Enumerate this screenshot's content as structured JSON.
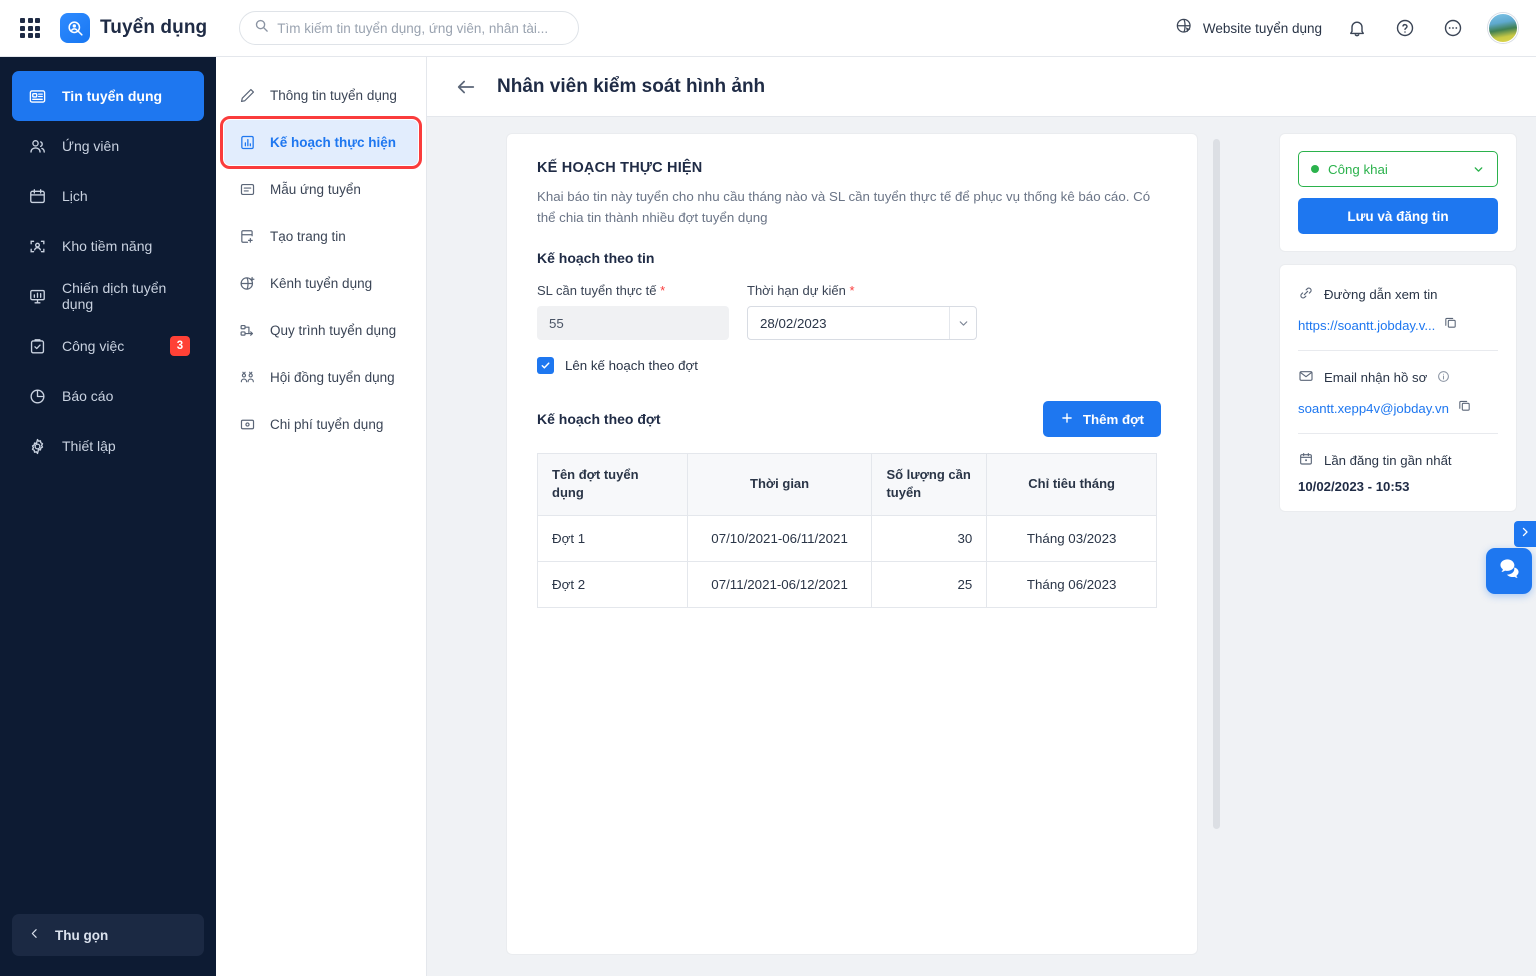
{
  "topbar": {
    "app_launcher": "grid-icon",
    "brand_name": "Tuyển dụng",
    "search_placeholder": "Tìm kiếm tin tuyển dụng, ứng viên, nhân tài...",
    "search_value": "",
    "website_link": "Website tuyển dụng"
  },
  "sidebar": {
    "items": [
      {
        "label": "Tin tuyển dụng",
        "icon": "news-card-icon",
        "active": true,
        "badge": ""
      },
      {
        "label": "Ứng viên",
        "icon": "users-icon",
        "active": false,
        "badge": ""
      },
      {
        "label": "Lịch",
        "icon": "calendar-icon",
        "active": false,
        "badge": ""
      },
      {
        "label": "Kho tiềm năng",
        "icon": "talent-scan-icon",
        "active": false,
        "badge": ""
      },
      {
        "label": "Chiến dịch tuyển dụng",
        "icon": "campaign-board-icon",
        "active": false,
        "badge": ""
      },
      {
        "label": "Công việc",
        "icon": "clipboard-check-icon",
        "active": false,
        "badge": "3"
      },
      {
        "label": "Báo cáo",
        "icon": "pie-chart-icon",
        "active": false,
        "badge": ""
      },
      {
        "label": "Thiết lập",
        "icon": "gear-icon",
        "active": false,
        "badge": ""
      }
    ],
    "collapse_label": "Thu gọn"
  },
  "subnav": {
    "items": [
      {
        "label": "Thông tin tuyển dụng",
        "icon": "pencil-icon",
        "active": false
      },
      {
        "label": "Kế hoạch thực hiện",
        "icon": "bar-chart-doc-icon",
        "active": true
      },
      {
        "label": "Mẫu ứng tuyển",
        "icon": "form-icon",
        "active": false
      },
      {
        "label": "Tạo trang tin",
        "icon": "page-plus-icon",
        "active": false
      },
      {
        "label": "Kênh tuyển dụng",
        "icon": "globe-plus-icon",
        "active": false
      },
      {
        "label": "Quy trình tuyển dụng",
        "icon": "flow-icon",
        "active": false
      },
      {
        "label": "Hội đồng tuyển dụng",
        "icon": "council-icon",
        "active": false
      },
      {
        "label": "Chi phí tuyển dụng",
        "icon": "cost-icon",
        "active": false
      }
    ]
  },
  "page": {
    "back_icon": "arrow-left-icon",
    "title": "Nhân viên kiểm soát hình ảnh"
  },
  "main": {
    "card_title": "KẾ HOẠCH THỰC HIỆN",
    "card_desc": "Khai báo tin này tuyển cho nhu cầu tháng nào và SL cần tuyển thực tế để phục vụ thống kê báo cáo. Có thể chia tin thành nhiều đợt tuyển dụng",
    "section_title": "Kế hoạch theo tin",
    "qty_label": "SL cần tuyển thực tế",
    "qty_value": "55",
    "deadline_label": "Thời hạn dự kiến",
    "deadline_value": "28/02/2023",
    "checkbox_label": "Lên kế hoạch theo đợt",
    "checkbox_checked": true,
    "batch_title": "Kế hoạch theo đợt",
    "add_batch_label": "Thêm đợt",
    "table": {
      "headers": [
        "Tên đợt tuyển dụng",
        "Thời gian",
        "Số lượng cần tuyển",
        "Chỉ tiêu tháng"
      ],
      "rows": [
        {
          "name": "Đợt 1",
          "period": "07/10/2021-06/11/2021",
          "qty": "30",
          "month_target": "Tháng 03/2023"
        },
        {
          "name": "Đợt 2",
          "period": "07/11/2021-06/12/2021",
          "qty": "25",
          "month_target": "Tháng 06/2023"
        }
      ]
    }
  },
  "right_panel": {
    "status": "Công khai",
    "status_color": "#2bb24c",
    "publish_label": "Lưu và đăng tin",
    "view_link_label": "Đường dẫn xem tin",
    "view_link_value": "https://soantt.jobday.v...",
    "email_label": "Email nhận hồ sơ",
    "email_value": "soantt.xepp4v@jobday.vn",
    "last_post_label": "Lần đăng tin gần nhất",
    "last_post_value": "10/02/2023 - 10:53"
  },
  "chat": {
    "tab_icon": "chevron-right-icon",
    "bubble_icon": "chat-bubbles-icon"
  }
}
